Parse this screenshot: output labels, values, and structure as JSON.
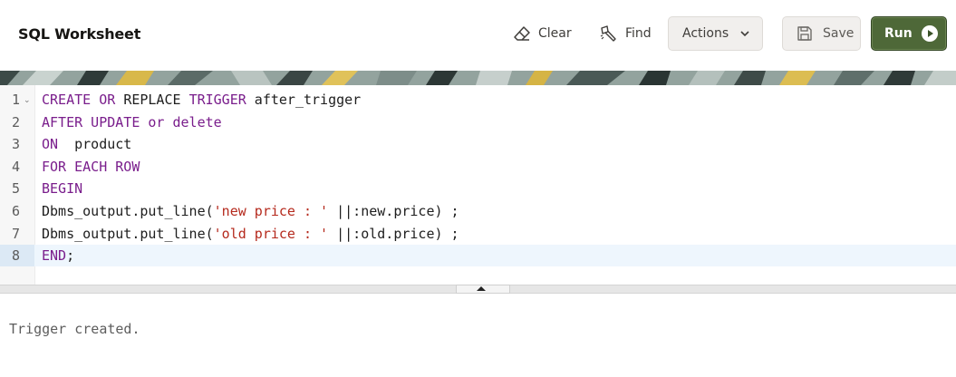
{
  "header": {
    "title": "SQL Worksheet",
    "clear_label": "Clear",
    "find_label": "Find",
    "actions_label": "Actions",
    "save_label": "Save",
    "run_label": "Run"
  },
  "colors": {
    "run_button": "#4e6838",
    "keyword": "#7a1e8c",
    "string": "#b52a1d",
    "active_line": "#eef6fd"
  },
  "editor": {
    "active_line": 8,
    "lines": [
      {
        "num": "1",
        "tokens": [
          {
            "t": "CREATE OR ",
            "c": "kw"
          },
          {
            "t": "REPLACE ",
            "c": ""
          },
          {
            "t": "TRIGGER",
            "c": "kw"
          },
          {
            "t": " after_trigger",
            "c": ""
          }
        ]
      },
      {
        "num": "2",
        "tokens": [
          {
            "t": "AFTER UPDATE or delete",
            "c": "kw"
          }
        ]
      },
      {
        "num": "3",
        "tokens": [
          {
            "t": "ON",
            "c": "kw"
          },
          {
            "t": "  product",
            "c": ""
          }
        ]
      },
      {
        "num": "4",
        "tokens": [
          {
            "t": "FOR EACH ROW",
            "c": "kw"
          }
        ]
      },
      {
        "num": "5",
        "tokens": [
          {
            "t": "BEGIN",
            "c": "kw"
          }
        ]
      },
      {
        "num": "6",
        "tokens": [
          {
            "t": "Dbms_output.put_line(",
            "c": ""
          },
          {
            "t": "'new price : '",
            "c": "str"
          },
          {
            "t": " ||:new.price) ;",
            "c": ""
          }
        ]
      },
      {
        "num": "7",
        "tokens": [
          {
            "t": "Dbms_output.put_line(",
            "c": ""
          },
          {
            "t": "'old price : '",
            "c": "str"
          },
          {
            "t": " ||:old.price) ;",
            "c": ""
          }
        ]
      },
      {
        "num": "8",
        "tokens": [
          {
            "t": "END",
            "c": "kw"
          },
          {
            "t": ";",
            "c": ""
          }
        ]
      }
    ]
  },
  "output": {
    "message": "Trigger created."
  }
}
